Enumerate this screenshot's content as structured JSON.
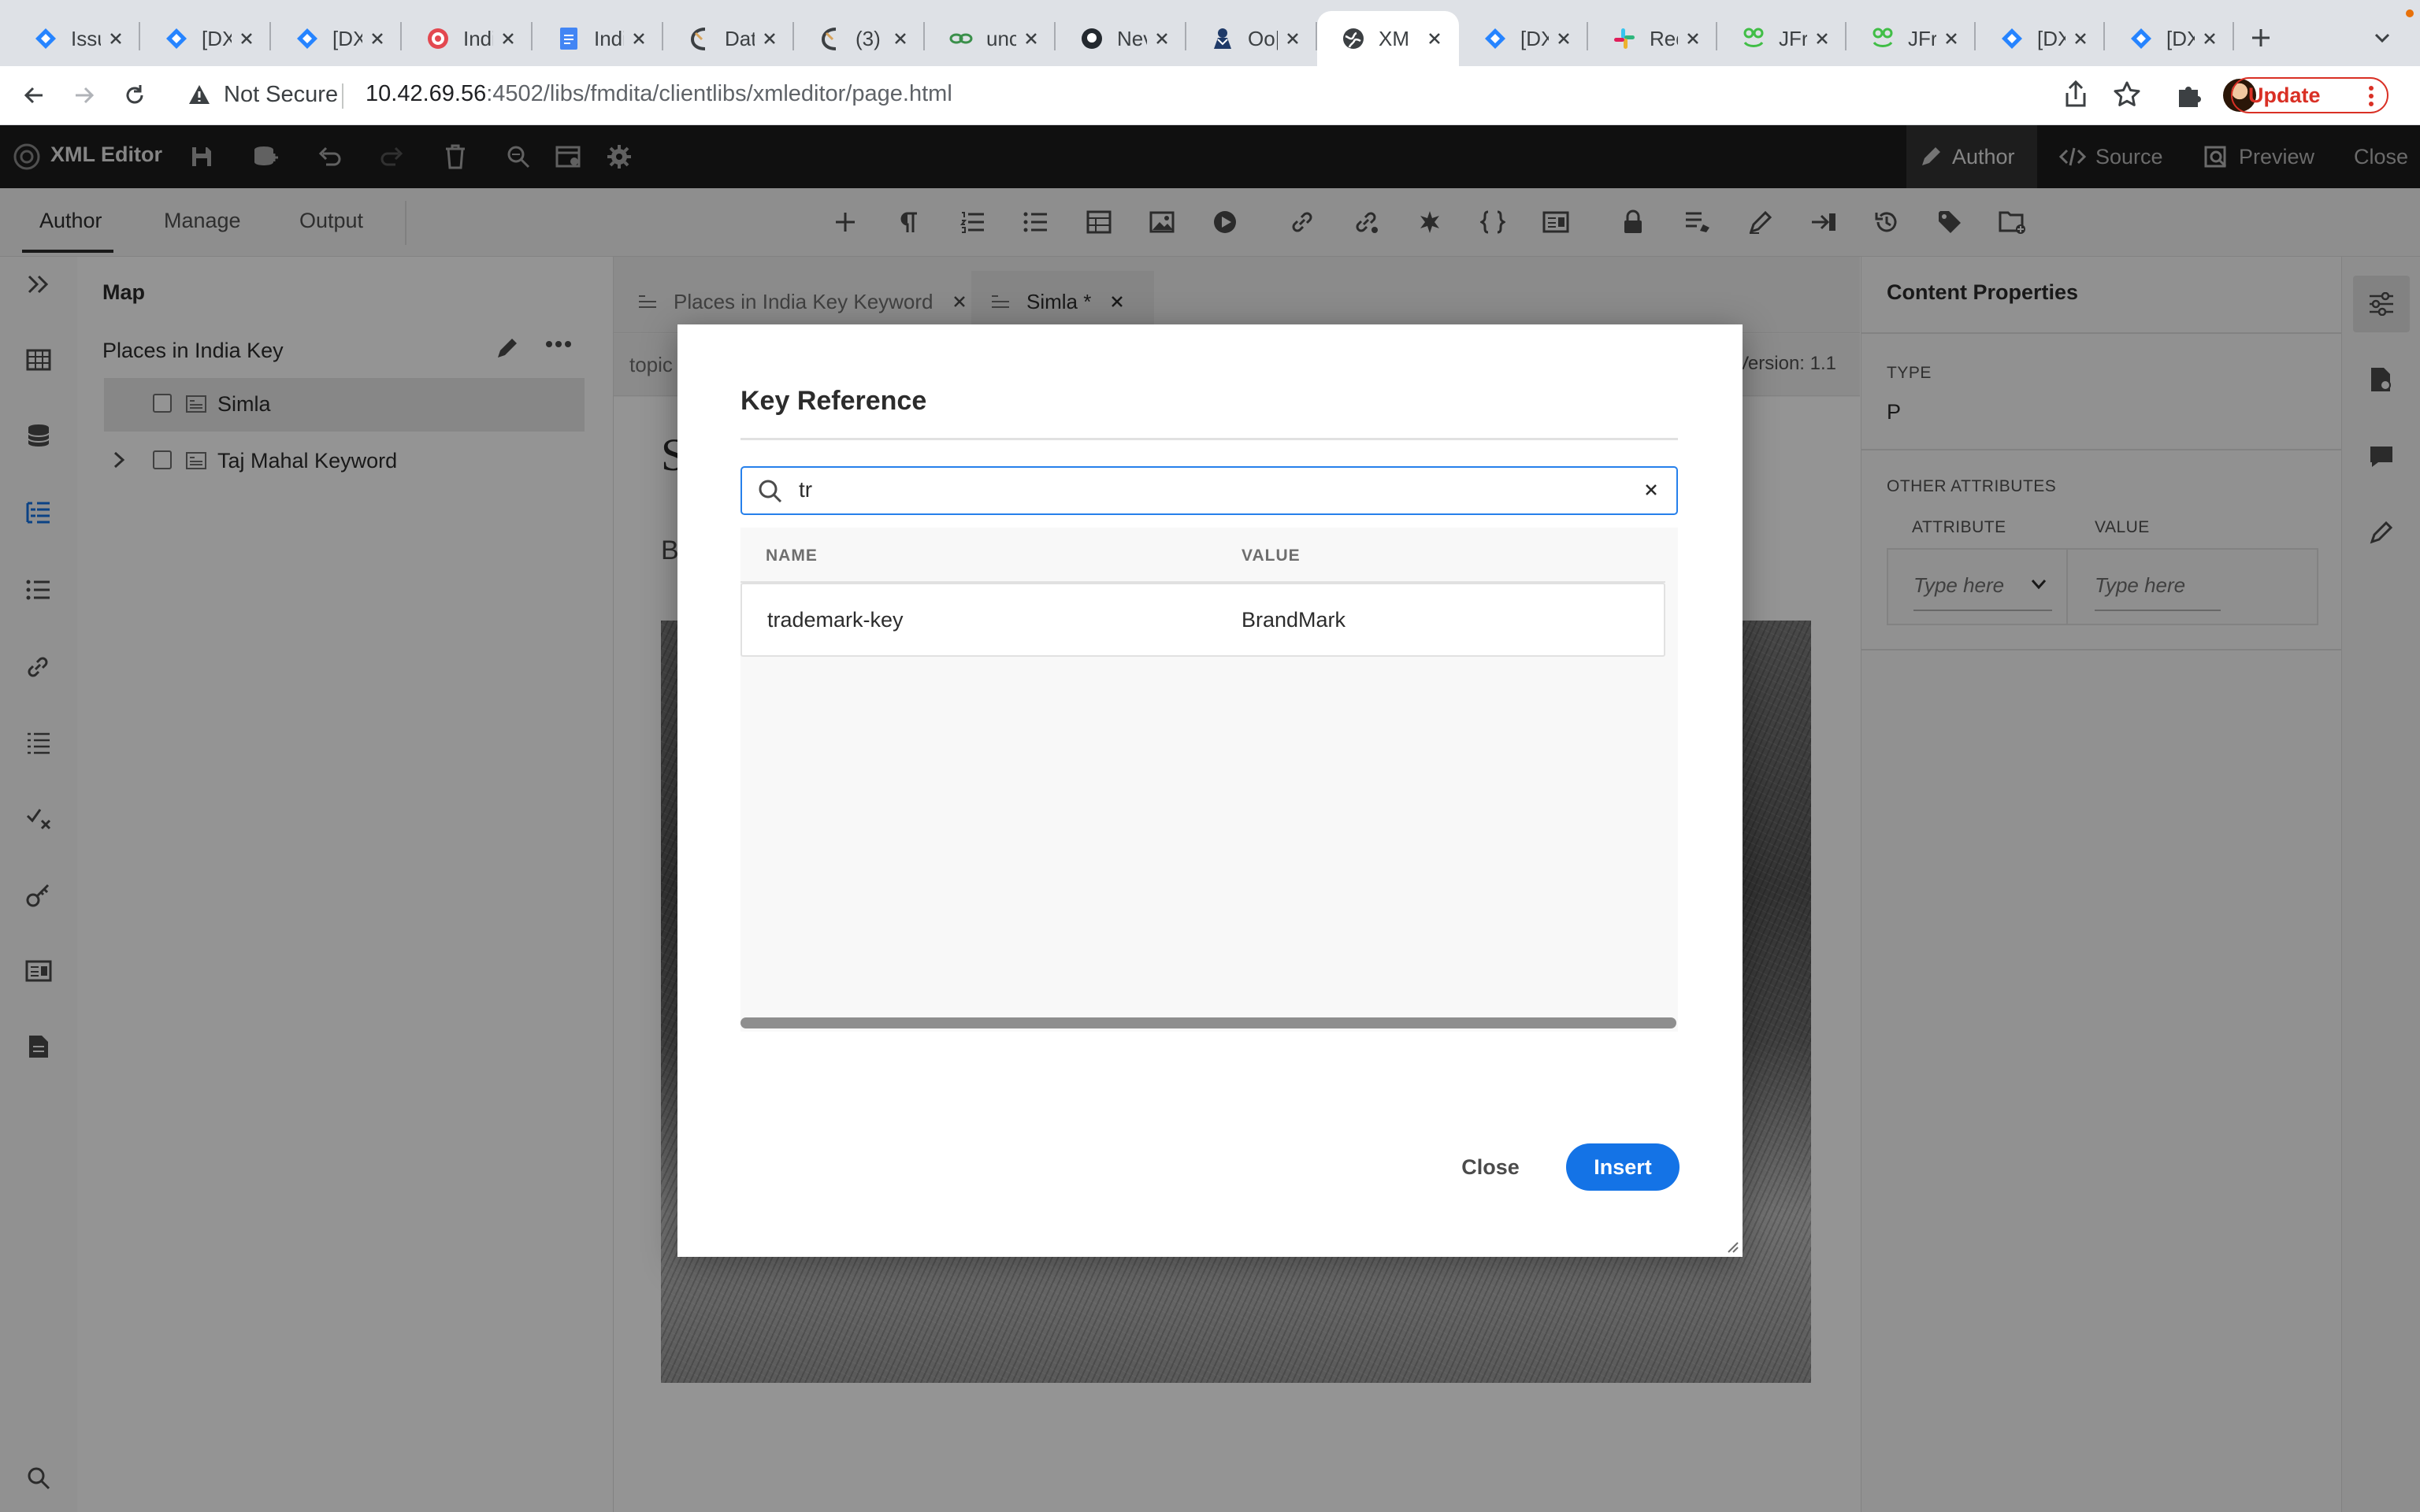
{
  "browser": {
    "tabs": [
      {
        "title": "Issu",
        "icon": "jira-icon",
        "active": false
      },
      {
        "title": "[DX",
        "icon": "jira-icon",
        "active": false
      },
      {
        "title": "[DX",
        "icon": "jira-icon",
        "active": false
      },
      {
        "title": "Indi",
        "icon": "target-icon",
        "active": false
      },
      {
        "title": "Indi",
        "icon": "docs-icon",
        "active": false
      },
      {
        "title": "Dat",
        "icon": "dash-icon",
        "active": false
      },
      {
        "title": "(3)",
        "icon": "dash-icon",
        "active": false
      },
      {
        "title": "unc",
        "icon": "link-icon",
        "active": false
      },
      {
        "title": "Nev",
        "icon": "github-icon",
        "active": false
      },
      {
        "title": "Oo|",
        "icon": "person-icon",
        "active": false
      },
      {
        "title": "XM",
        "icon": "globe-icon",
        "active": true
      },
      {
        "title": "[DXML-",
        "icon": "jira-icon",
        "active": false
      },
      {
        "title": "Redirec",
        "icon": "slack-icon",
        "active": false
      },
      {
        "title": "JFrog",
        "icon": "jfrog-icon",
        "active": false
      },
      {
        "title": "JFrog",
        "icon": "jfrog-icon",
        "active": false
      },
      {
        "title": "[DXML-",
        "icon": "jira-icon",
        "active": false
      },
      {
        "title": "[DXML-",
        "icon": "jira-icon",
        "active": false
      }
    ],
    "security_label": "Not Secure",
    "url_host": "10.42.69.56",
    "url_rest": ":4502/libs/fmdita/clientlibs/xmleditor/page.html",
    "update_label": "Update",
    "colors": {
      "tabstrip": "#dee1e6",
      "update": "#d93025"
    }
  },
  "app": {
    "title": "XML Editor",
    "modes": {
      "author": "Author",
      "source": "Source",
      "preview": "Preview",
      "close": "Close"
    },
    "subtabs": {
      "author": "Author",
      "manage": "Manage",
      "output": "Output"
    }
  },
  "map": {
    "heading": "Map",
    "root_label": "Places in India Key",
    "items": [
      {
        "label": "Simla",
        "selected": true,
        "expandable": false
      },
      {
        "label": "Taj Mahal Keyword",
        "selected": false,
        "expandable": true
      }
    ]
  },
  "editor": {
    "doc_tabs": [
      {
        "label": "Places in India Key Keyword",
        "active": false
      },
      {
        "label": "Simla *",
        "active": true
      }
    ],
    "breadcrumb": "topic",
    "version": "Version: 1.1",
    "title_fragment": "S",
    "para_fragment": "B"
  },
  "properties": {
    "title": "Content Properties",
    "type_label": "TYPE",
    "type_value": "P",
    "other_label": "OTHER ATTRIBUTES",
    "attribute_col": "ATTRIBUTE",
    "value_col": "VALUE",
    "attribute_placeholder": "Type here",
    "value_placeholder": "Type here"
  },
  "dialog": {
    "title": "Key Reference",
    "search_value": "tr",
    "columns": {
      "name": "NAME",
      "value": "VALUE"
    },
    "rows": [
      {
        "name": "trademark-key",
        "value": "BrandMark"
      }
    ],
    "close_label": "Close",
    "insert_label": "Insert",
    "colors": {
      "accent": "#1473e6",
      "focus": "#2680eb"
    }
  }
}
